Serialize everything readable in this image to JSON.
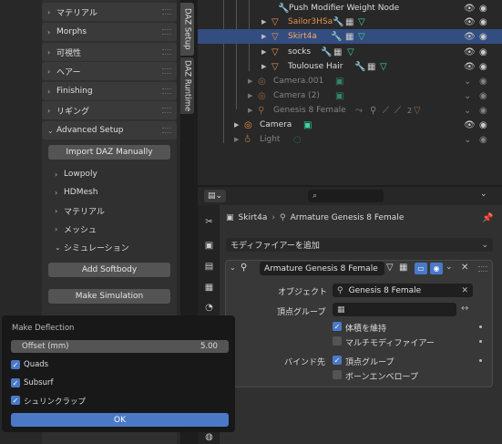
{
  "left_panel": {
    "rows": [
      "マテリアル",
      "Morphs",
      "可視性",
      "ヘアー",
      "Finishing",
      "リギング"
    ],
    "advanced_setup": "Advanced Setup",
    "import_button": "Import DAZ Manually",
    "sub_items": [
      "Lowpoly",
      "HDMesh",
      "マテリアル",
      "メッシュ"
    ],
    "simulation": "シミュレーション",
    "add_softbody": "Add Softbody",
    "make_simulation": "Make Simulation"
  },
  "tabs": {
    "daz_setup": "DAZ Setup",
    "daz_runtime": "DAZ Runtime"
  },
  "outliner": {
    "rows": [
      "Push Modifier Weight Node",
      "Sailor3HSa",
      "Skirt4a",
      "socks",
      "Toulouse Hair",
      "Camera.001",
      "Camera (2)",
      "Genesis 8 Female",
      "Camera",
      "Light"
    ],
    "badge": "2"
  },
  "properties": {
    "search_placeholder": "",
    "breadcrumb_object": "Skirt4a",
    "breadcrumb_arrow": "›",
    "breadcrumb_target": "Armature Genesis 8 Female",
    "add_modifier": "モディファイアーを追加",
    "modifier_name": "Armature Genesis 8 Female",
    "object_label": "オブジェクト",
    "object_value": "Genesis 8 Female",
    "vertex_group_label": "頂点グループ",
    "preserve_volume": "体積を維持",
    "multi_modifier": "マルチモディファイアー",
    "bind_to_label": "バインド先",
    "vertex_groups": "頂点グループ",
    "bone_envelopes": "ボーンエンベロープ"
  },
  "popup": {
    "title": "Make Deflection",
    "offset_label": "Offset (mm)",
    "offset_value": "5.00",
    "quads": "Quads",
    "subsurf": "Subsurf",
    "shrinkwrap": "シュリンクラップ",
    "ok": "OK"
  },
  "colors": {
    "accent_blue": "#4a79c8",
    "selection": "#334d80",
    "object_orange": "#e8914d",
    "data_green": "#3dd3a2"
  }
}
